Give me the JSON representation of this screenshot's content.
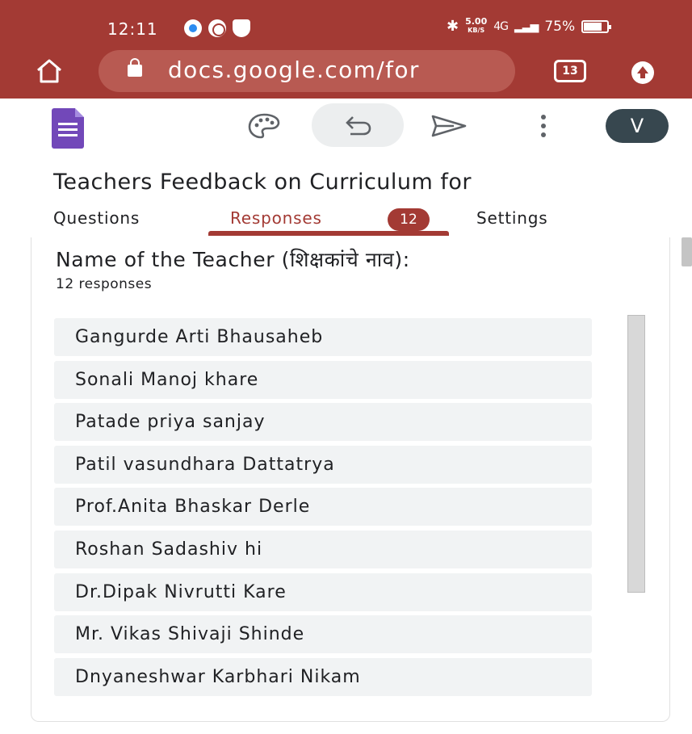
{
  "status_bar": {
    "time": "12:11",
    "speed_value": "5.00",
    "speed_unit": "KB/S",
    "network": "4G",
    "battery": "75%"
  },
  "url_bar": {
    "url": "docs.google.com/for",
    "tab_count": "13"
  },
  "form": {
    "title": "Teachers Feedback on Curriculum for"
  },
  "tabs": {
    "questions": "Questions",
    "responses": "Responses",
    "responses_count": "12",
    "settings": "Settings"
  },
  "avatar_letter": "V",
  "question": {
    "title": "Name of the Teacher (शिक्षकांचे नाव):",
    "count": "12 responses",
    "responses": [
      "Gangurde Arti Bhausaheb",
      "Sonali Manoj khare",
      "Patade priya sanjay",
      "Patil vasundhara Dattatrya",
      "Prof.Anita Bhaskar Derle",
      "Roshan Sadashiv hi",
      "Dr.Dipak Nivrutti Kare",
      "Mr. Vikas Shivaji Shinde",
      "Dnyaneshwar Karbhari Nikam"
    ]
  },
  "colors": {
    "browser_accent": "#a33a34",
    "forms_purple": "#7248b9",
    "avatar_bg": "#37474f",
    "response_bg": "#f1f3f4"
  },
  "icons": [
    "home-icon",
    "lock-icon",
    "tabs-icon",
    "upload-icon",
    "forms-logo-icon",
    "palette-icon",
    "undo-icon",
    "send-icon",
    "more-vert-icon"
  ]
}
